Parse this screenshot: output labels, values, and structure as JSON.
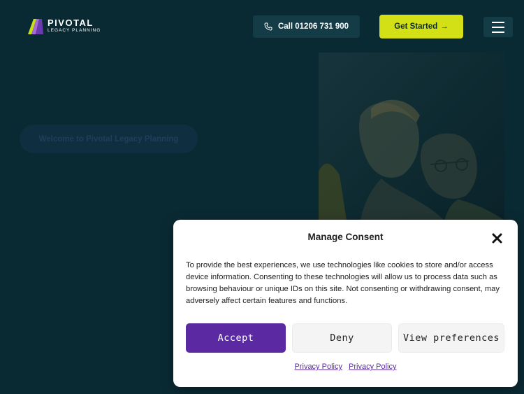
{
  "header": {
    "logo": {
      "name": "PIVOTAL",
      "subtitle": "LEGACY PLANNING"
    },
    "call_label": "Call 01206 731 900",
    "get_started_label": "Get Started",
    "arrow": "→"
  },
  "hero": {
    "welcome_text": "Welcome to Pivotal Legacy Planning"
  },
  "consent": {
    "title": "Manage Consent",
    "body": "To provide the best experiences, we use technologies like cookies to store and/or access device information. Consenting to these technologies will allow us to process data such as browsing behaviour or unique IDs on this site. Not consenting or withdrawing consent, may adversely affect certain features and functions.",
    "accept_label": "Accept",
    "deny_label": "Deny",
    "preferences_label": "View preferences",
    "links": [
      "Privacy Policy",
      "Privacy Policy"
    ]
  },
  "colors": {
    "background": "#0a2a33",
    "accent_lime": "#d4e016",
    "accent_purple": "#5b2aa3"
  },
  "icons": [
    "pivotal-logo-icon",
    "phone-icon",
    "arrow-right-icon",
    "hamburger-menu-icon",
    "close-icon"
  ]
}
